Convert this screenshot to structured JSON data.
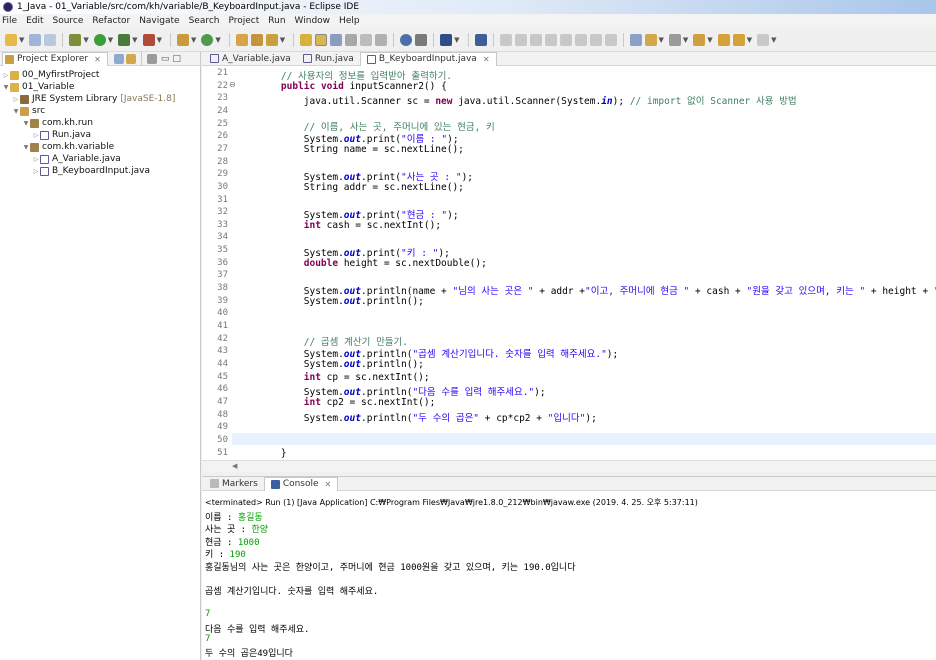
{
  "window": {
    "title": "1_Java - 01_Variable/src/com/kh/variable/B_KeyboardInput.java - Eclipse IDE"
  },
  "menu": [
    "File",
    "Edit",
    "Source",
    "Refactor",
    "Navigate",
    "Search",
    "Project",
    "Run",
    "Window",
    "Help"
  ],
  "project_explorer": {
    "tab_label": "Project Explorer",
    "tree": [
      {
        "label": "00_MyfirstProject",
        "depth": 0,
        "icon": "project-icon"
      },
      {
        "label": "01_Variable",
        "depth": 0,
        "icon": "project-icon"
      },
      {
        "label": "JRE System Library",
        "suffix": "[JavaSE-1.8]",
        "depth": 1,
        "icon": "library-icon"
      },
      {
        "label": "src",
        "depth": 1,
        "icon": "source-folder-icon"
      },
      {
        "label": "com.kh.run",
        "depth": 2,
        "icon": "package-icon"
      },
      {
        "label": "Run.java",
        "depth": 3,
        "icon": "java-file-icon"
      },
      {
        "label": "com.kh.variable",
        "depth": 2,
        "icon": "package-icon"
      },
      {
        "label": "A_Variable.java",
        "depth": 3,
        "icon": "java-file-icon"
      },
      {
        "label": "B_KeyboardInput.java",
        "depth": 3,
        "icon": "java-file-icon"
      }
    ]
  },
  "editor": {
    "tabs": [
      {
        "label": "A_Variable.java",
        "active": false
      },
      {
        "label": "Run.java",
        "active": false
      },
      {
        "label": "B_KeyboardInput.java",
        "active": true
      }
    ],
    "lines": [
      {
        "n": "21",
        "text": "    // 사용자의 정보를 입력받아 출력하기."
      },
      {
        "n": "22",
        "text": "    public void inputScanner2() {"
      },
      {
        "n": "23",
        "text": "        java.util.Scanner sc = new java.util.Scanner(System.in); // import 없이 Scanner 사용 방법"
      },
      {
        "n": "24",
        "text": ""
      },
      {
        "n": "25",
        "text": "        // 이름, 사는 곳, 주머니에 있는 현금, 키"
      },
      {
        "n": "26",
        "text": "        System.out.print(\"이름 : \");"
      },
      {
        "n": "27",
        "text": "        String name = sc.nextLine();"
      },
      {
        "n": "28",
        "text": ""
      },
      {
        "n": "29",
        "text": "        System.out.print(\"사는 곳 : \");"
      },
      {
        "n": "30",
        "text": "        String addr = sc.nextLine();"
      },
      {
        "n": "31",
        "text": ""
      },
      {
        "n": "32",
        "text": "        System.out.print(\"현금 : \");"
      },
      {
        "n": "33",
        "text": "        int cash = sc.nextInt();"
      },
      {
        "n": "34",
        "text": ""
      },
      {
        "n": "35",
        "text": "        System.out.print(\"키 : \");"
      },
      {
        "n": "36",
        "text": "        double height = sc.nextDouble();"
      },
      {
        "n": "37",
        "text": ""
      },
      {
        "n": "38",
        "text": "        System.out.println(name + \"님의 사는 곳은 \" + addr +\"이고, 주머니에 현금 \" + cash + \"원을 갖고 있으며, 키는 \" + height + \"입니다\");"
      },
      {
        "n": "39",
        "text": "        System.out.println();"
      },
      {
        "n": "40",
        "text": ""
      },
      {
        "n": "41",
        "text": ""
      },
      {
        "n": "42",
        "text": "        // 곱셈 계산기 만들기."
      },
      {
        "n": "43",
        "text": "        System.out.println(\"곱셈 계산기입니다. 숫자를 입력 해주세요.\");"
      },
      {
        "n": "44",
        "text": "        System.out.println();"
      },
      {
        "n": "45",
        "text": "        int cp = sc.nextInt();"
      },
      {
        "n": "46",
        "text": "        System.out.println(\"다음 수를 입력 해주세요.\");"
      },
      {
        "n": "47",
        "text": "        int cp2 = sc.nextInt();"
      },
      {
        "n": "48",
        "text": "        System.out.println(\"두 수의 곱은\" + cp*cp2 + \"입니다\");"
      },
      {
        "n": "49",
        "text": ""
      },
      {
        "n": "50",
        "text": ""
      },
      {
        "n": "51",
        "text": "    }"
      }
    ]
  },
  "console": {
    "tabs": [
      {
        "label": "Markers",
        "active": false
      },
      {
        "label": "Console",
        "active": true
      }
    ],
    "header": "<terminated> Run (1) [Java Application] C:₩Program Files₩Java₩jre1.8.0_212₩bin₩javaw.exe (2019. 4. 25. 오후 5:37:11)",
    "lines": [
      {
        "prompt": "이름 : ",
        "input": "홍길동"
      },
      {
        "prompt": "사는 곳 : ",
        "input": "한양"
      },
      {
        "prompt": "현금 : ",
        "input": "1000"
      },
      {
        "prompt": "키 : ",
        "input": "190"
      },
      {
        "prompt": "홍길동님의 사는 곳은 한양이고, 주머니에 현금 1000원을 갖고 있으며, 키는 190.0입니다",
        "input": ""
      },
      {
        "prompt": "",
        "input": ""
      },
      {
        "prompt": "곱셈 계산기입니다. 숫자를 입력 해주세요.",
        "input": ""
      },
      {
        "prompt": "",
        "input": ""
      },
      {
        "prompt": "",
        "input": "7"
      },
      {
        "prompt": "다음 수를 입력 해주세요.",
        "input": ""
      },
      {
        "prompt": "",
        "input": "7"
      },
      {
        "prompt": "두 수의 곱은49입니다",
        "input": ""
      }
    ]
  },
  "colors": {
    "keyword": "#7f0055",
    "string": "#2a00ff",
    "comment": "#3f7f5f",
    "static_field": "#0000c0",
    "console_input": "#00a000"
  }
}
